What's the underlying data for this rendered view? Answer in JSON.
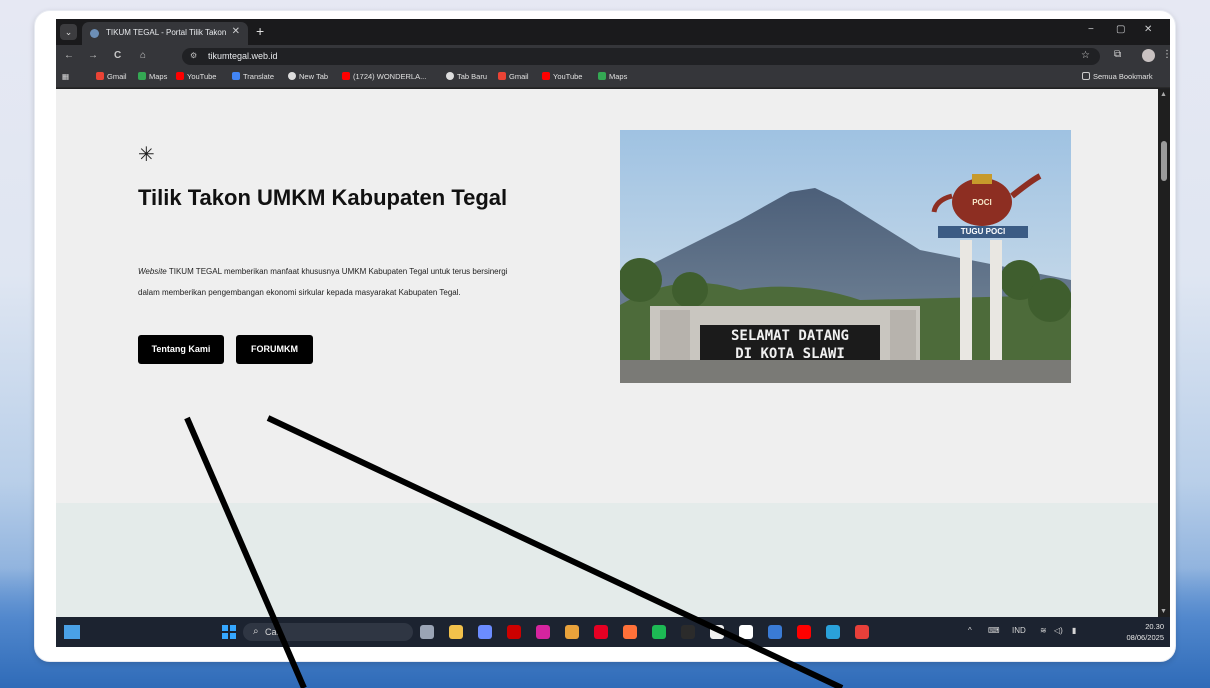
{
  "browser": {
    "tab_title": "TIKUM TEGAL - Portal Tilik Takon",
    "tab_close": "✕",
    "new_tab": "+",
    "window_controls": [
      "−",
      "▢",
      "✕"
    ],
    "url": "tikumtegal.web.id",
    "nav_buttons": [
      "←",
      "→",
      "C",
      "⌂"
    ],
    "bookmarks": [
      {
        "label": "Gmail",
        "color": "#ea4335"
      },
      {
        "label": "Maps",
        "color": "#34a853"
      },
      {
        "label": "YouTube",
        "color": "#ff0000"
      },
      {
        "label": "Translate",
        "color": "#4285f4"
      },
      {
        "label": "New Tab",
        "color": "#dddddd"
      },
      {
        "label": "(1724) WONDERLA...",
        "color": "#ff0000"
      },
      {
        "label": "Tab Baru",
        "color": "#dddddd"
      },
      {
        "label": "Gmail",
        "color": "#ea4335"
      },
      {
        "label": "YouTube",
        "color": "#ff0000"
      },
      {
        "label": "Maps",
        "color": "#34a853"
      }
    ],
    "all_bookmarks": "Semua Bookmark"
  },
  "page": {
    "asterisk": "✳",
    "headline": "Tilik Takon UMKM Kabupaten Tegal",
    "description_italic": "Website",
    "description": " TIKUM TEGAL memberikan manfaat khususnya UMKM Kabupaten Tegal untuk terus bersinergi dalam memberikan pengembangan ekonomi sirkular kepada masyarakat Kabupaten Tegal.",
    "buttons": {
      "about": "Tentang Kami",
      "forum": "FORUMKM"
    },
    "hero": {
      "sign_line1": "SELAMAT DATANG",
      "sign_line2": "DI KOTA SLAWI",
      "monument_label": "TUGU POCI",
      "teapot_label": "POCI"
    }
  },
  "taskbar": {
    "search_placeholder": "Cari",
    "language": "IND",
    "time": "20.30",
    "date": "08/06/2025",
    "apps": [
      {
        "name": "task-view",
        "color": "#9aa4b5"
      },
      {
        "name": "file-explorer",
        "color": "#f2c14b"
      },
      {
        "name": "copilot",
        "color": "#6b8cff"
      },
      {
        "name": "illustrator",
        "color": "#cc0000"
      },
      {
        "name": "instagram",
        "color": "#d6249f"
      },
      {
        "name": "chrome",
        "color": "#e9a23b"
      },
      {
        "name": "pinterest",
        "color": "#e60023"
      },
      {
        "name": "firefox",
        "color": "#ff7139"
      },
      {
        "name": "spotify",
        "color": "#1db954"
      },
      {
        "name": "media",
        "color": "#2b2b2b"
      },
      {
        "name": "docs",
        "color": "#f0f0f0"
      },
      {
        "name": "files",
        "color": "#ffffff"
      },
      {
        "name": "store",
        "color": "#3a7bd5"
      },
      {
        "name": "youtube",
        "color": "#ff0000"
      },
      {
        "name": "telegram",
        "color": "#2aa1da"
      },
      {
        "name": "wps",
        "color": "#e8403a"
      }
    ]
  }
}
